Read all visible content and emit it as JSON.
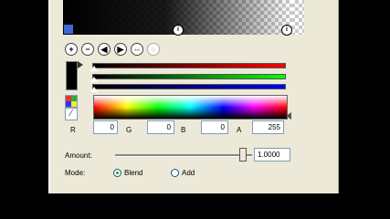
{
  "top_strip": {
    "mid_handle": "i",
    "end_handle": "i"
  },
  "toolbar": {
    "buttons": [
      {
        "icon": "add-icon",
        "glyph": "+"
      },
      {
        "icon": "remove-icon",
        "glyph": "−"
      },
      {
        "icon": "move-left-icon",
        "glyph": "◀"
      },
      {
        "icon": "move-right-icon",
        "glyph": "▶"
      },
      {
        "icon": "duplicate-icon",
        "glyph": "⇔"
      },
      {
        "icon": "disabled-icon",
        "glyph": "○"
      }
    ]
  },
  "channels": {
    "r_label": "R",
    "r_value": "0",
    "g_label": "G",
    "g_value": "0",
    "b_label": "B",
    "b_value": "0",
    "a_label": "A",
    "a_value": "255"
  },
  "amount": {
    "label": "Amount:",
    "value": "1.0000",
    "slider_fraction": 0.93
  },
  "mode": {
    "label": "Mode:",
    "options": [
      "Blend",
      "Add"
    ],
    "selected": "Blend"
  },
  "colors": {
    "panel": "#ece9d8",
    "field_border": "#7f9db9",
    "radio_dot": "#21a121"
  }
}
